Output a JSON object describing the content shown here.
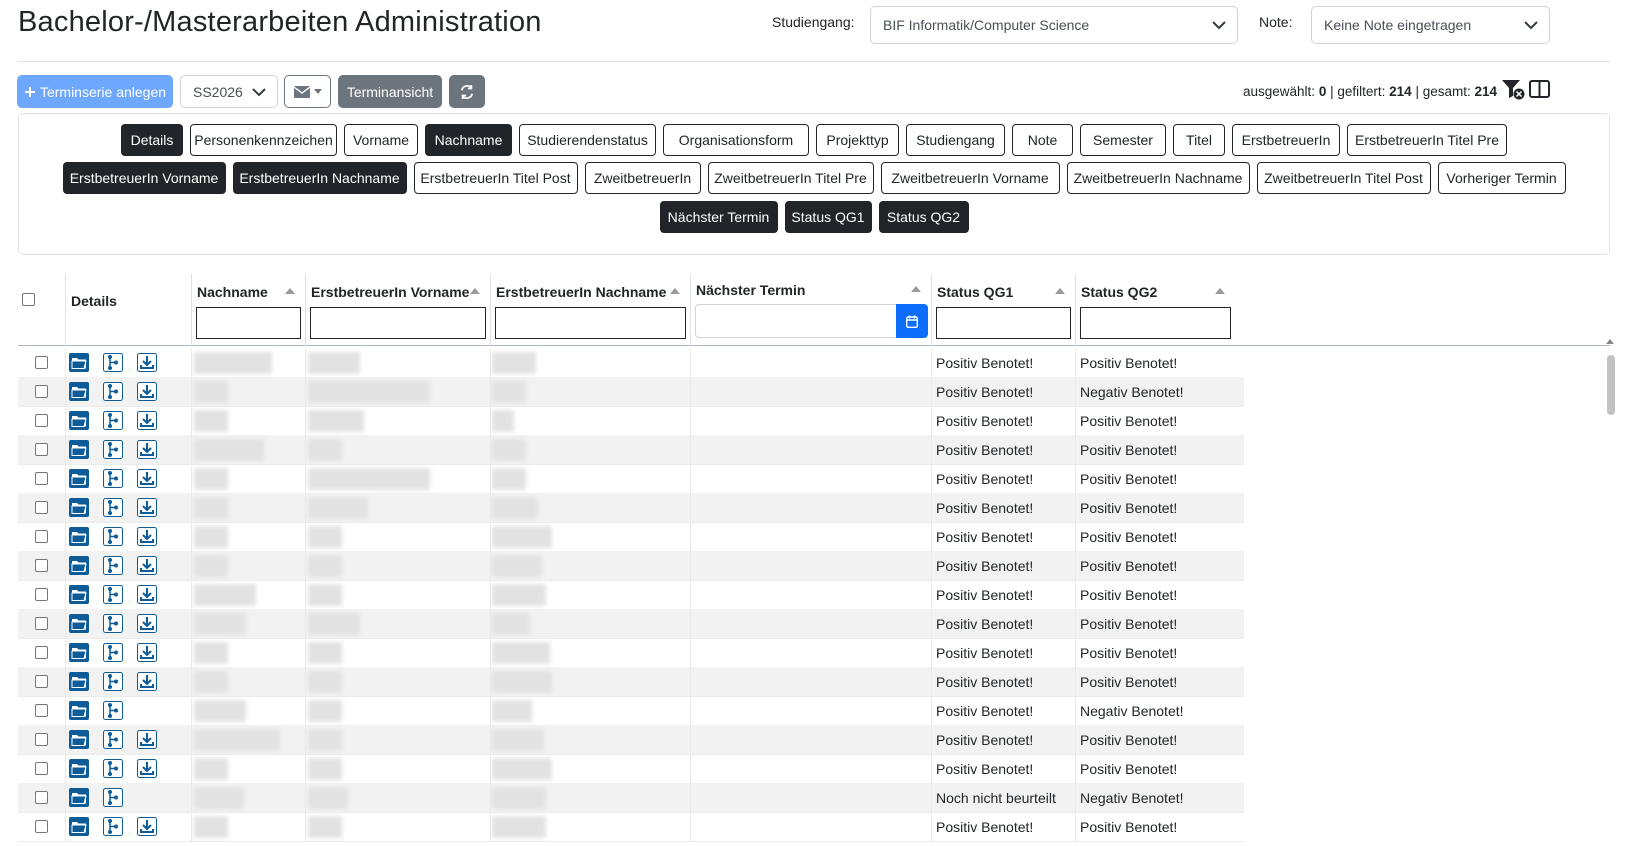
{
  "header": {
    "title": "Bachelor-/Masterarbeiten Administration",
    "studiengang_label": "Studiengang:",
    "studiengang_value": "BIF Informatik/Computer Science",
    "note_label": "Note:",
    "note_value": "Keine Note eingetragen"
  },
  "toolbar": {
    "add_label": "Terminserie anlegen",
    "add_icon": "plus-icon",
    "semester_value": "SS2026",
    "mail_icon": "envelope-icon",
    "terminansicht_label": "Terminansicht",
    "refresh_icon": "refresh-icon"
  },
  "counters": {
    "selected_label": "ausgewählt:",
    "selected": "0",
    "filtered_label": "gefiltert:",
    "filtered": "214",
    "total_label": "gesamt:",
    "total": "214"
  },
  "column_toggles": [
    {
      "label": "Details",
      "active": true
    },
    {
      "label": "Personenkennzeichen",
      "active": false
    },
    {
      "label": "Vorname",
      "active": false
    },
    {
      "label": "Nachname",
      "active": true
    },
    {
      "label": "Studierendenstatus",
      "active": false
    },
    {
      "label": "Organisationsform",
      "active": false
    },
    {
      "label": "Projekttyp",
      "active": false
    },
    {
      "label": "Studiengang",
      "active": false
    },
    {
      "label": "Note",
      "active": false
    },
    {
      "label": "Semester",
      "active": false
    },
    {
      "label": "Titel",
      "active": false
    },
    {
      "label": "ErstbetreuerIn",
      "active": false
    },
    {
      "label": "ErstbetreuerIn Titel Pre",
      "active": false
    },
    {
      "label": "ErstbetreuerIn Vorname",
      "active": true
    },
    {
      "label": "ErstbetreuerIn Nachname",
      "active": true
    },
    {
      "label": "ErstbetreuerIn Titel Post",
      "active": false
    },
    {
      "label": "ZweitbetreuerIn",
      "active": false
    },
    {
      "label": "ZweitbetreuerIn Titel Pre",
      "active": false
    },
    {
      "label": "ZweitbetreuerIn Vorname",
      "active": false
    },
    {
      "label": "ZweitbetreuerIn Nachname",
      "active": false
    },
    {
      "label": "ZweitbetreuerIn Titel Post",
      "active": false
    },
    {
      "label": "Vorheriger Termin",
      "active": false
    },
    {
      "label": "Nächster Termin",
      "active": true
    },
    {
      "label": "Status QG1",
      "active": true
    },
    {
      "label": "Status QG2",
      "active": true
    }
  ],
  "table": {
    "columns": [
      "Details",
      "Nachname",
      "ErstbetreuerIn Vorname",
      "ErstbetreuerIn Nachname",
      "Nächster Termin",
      "Status QG1",
      "Status QG2"
    ],
    "rows": [
      {
        "qg1": "Positiv Benotet!",
        "qg2": "Positiv Benotet!",
        "download": true
      },
      {
        "qg1": "Positiv Benotet!",
        "qg2": "Negativ Benotet!",
        "download": true
      },
      {
        "qg1": "Positiv Benotet!",
        "qg2": "Positiv Benotet!",
        "download": true
      },
      {
        "qg1": "Positiv Benotet!",
        "qg2": "Positiv Benotet!",
        "download": true
      },
      {
        "qg1": "Positiv Benotet!",
        "qg2": "Positiv Benotet!",
        "download": true
      },
      {
        "qg1": "Positiv Benotet!",
        "qg2": "Positiv Benotet!",
        "download": true
      },
      {
        "qg1": "Positiv Benotet!",
        "qg2": "Positiv Benotet!",
        "download": true
      },
      {
        "qg1": "Positiv Benotet!",
        "qg2": "Positiv Benotet!",
        "download": true
      },
      {
        "qg1": "Positiv Benotet!",
        "qg2": "Positiv Benotet!",
        "download": true
      },
      {
        "qg1": "Positiv Benotet!",
        "qg2": "Positiv Benotet!",
        "download": true
      },
      {
        "qg1": "Positiv Benotet!",
        "qg2": "Positiv Benotet!",
        "download": true
      },
      {
        "qg1": "Positiv Benotet!",
        "qg2": "Positiv Benotet!",
        "download": true
      },
      {
        "qg1": "Positiv Benotet!",
        "qg2": "Negativ Benotet!",
        "download": false
      },
      {
        "qg1": "Positiv Benotet!",
        "qg2": "Positiv Benotet!",
        "download": true
      },
      {
        "qg1": "Positiv Benotet!",
        "qg2": "Positiv Benotet!",
        "download": true
      },
      {
        "qg1": "Noch nicht beurteilt",
        "qg2": "Negativ Benotet!",
        "download": false
      },
      {
        "qg1": "Positiv Benotet!",
        "qg2": "Positiv Benotet!",
        "download": true
      }
    ]
  },
  "colors": {
    "primary": "#6ea8fe",
    "secondary": "#6c757d",
    "dark": "#212529",
    "icon_blue": "#0d5c99",
    "date_button": "#0d6efd"
  }
}
